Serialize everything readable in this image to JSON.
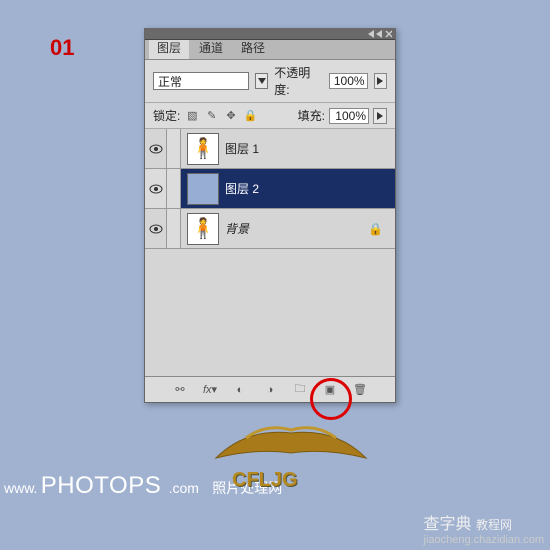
{
  "step": "01",
  "panel": {
    "tabs": [
      "图层",
      "通道",
      "路径"
    ],
    "active_tab": 0,
    "blend_mode": "正常",
    "opacity_label": "不透明度:",
    "opacity_value": "100%",
    "lock_label": "锁定:",
    "fill_label": "填充:",
    "fill_value": "100%",
    "layers": [
      {
        "name": "图层 1",
        "visible": true,
        "thumb": "person"
      },
      {
        "name": "图层 2",
        "visible": true,
        "thumb": "blue",
        "selected": true
      },
      {
        "name": "背景",
        "visible": true,
        "thumb": "person",
        "italic": true,
        "locked": true
      }
    ],
    "footer_icons": [
      "link-icon",
      "fx-icon",
      "mask-icon",
      "adjust-icon",
      "group-icon",
      "new-layer-icon",
      "trash-icon"
    ]
  },
  "watermarks": {
    "photops_domain": "PHOTOPS",
    "photops_prefix": "www.",
    "photops_com": ".com",
    "photops_cn": "照片处理网",
    "gold_text": "CFLJG",
    "chazidian": "查字典",
    "chazidian_sub": "教程网",
    "chazidian_url": "jiaocheng.chazidian.com"
  },
  "colors": {
    "accent": "#1a2e66",
    "step_red": "#c00",
    "circle_red": "#d00",
    "gold": "#b5891f"
  }
}
